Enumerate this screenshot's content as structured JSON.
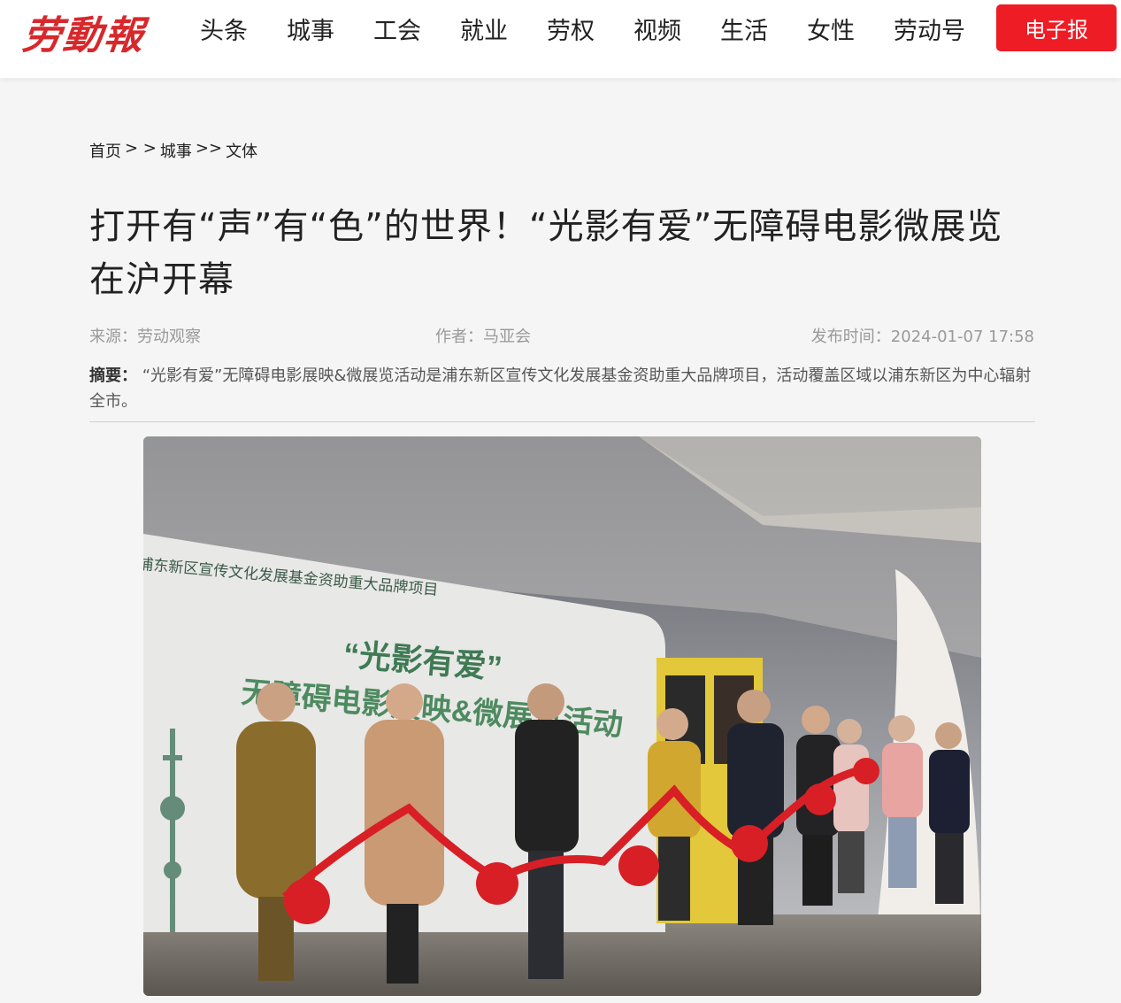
{
  "header": {
    "logo_text": "劳動報",
    "nav_items": [
      "头条",
      "城事",
      "工会",
      "就业",
      "劳权",
      "视频",
      "生活",
      "女性",
      "劳动号"
    ],
    "epaper_button": "电子报",
    "accent_color": "#ee1c25"
  },
  "breadcrumb": {
    "home": "首页",
    "sep1": "> >",
    "section": "城事",
    "sep2": ">>",
    "subsection": "文体"
  },
  "article": {
    "title": "打开有“声”有“色”的世界！“光影有爱”无障碍电影微展览在沪开幕",
    "source": "来源：劳动观察",
    "author": "作者：马亚会",
    "published": "发布时间：2024-01-07 17:58",
    "summary_label": "摘要：",
    "summary_text": "“光影有爱”无障碍电影展映&微展览活动是浦东新区宣传文化发展基金资助重大品牌项目，活动覆盖区域以浦东新区为中心辐射全市。"
  },
  "photo": {
    "banner_line1": "浦东新区宣传文化发展基金资助重大品牌项目",
    "banner_title": "“光影有爱”",
    "banner_subtitle": "无障碍电影展映&微展览活动"
  }
}
